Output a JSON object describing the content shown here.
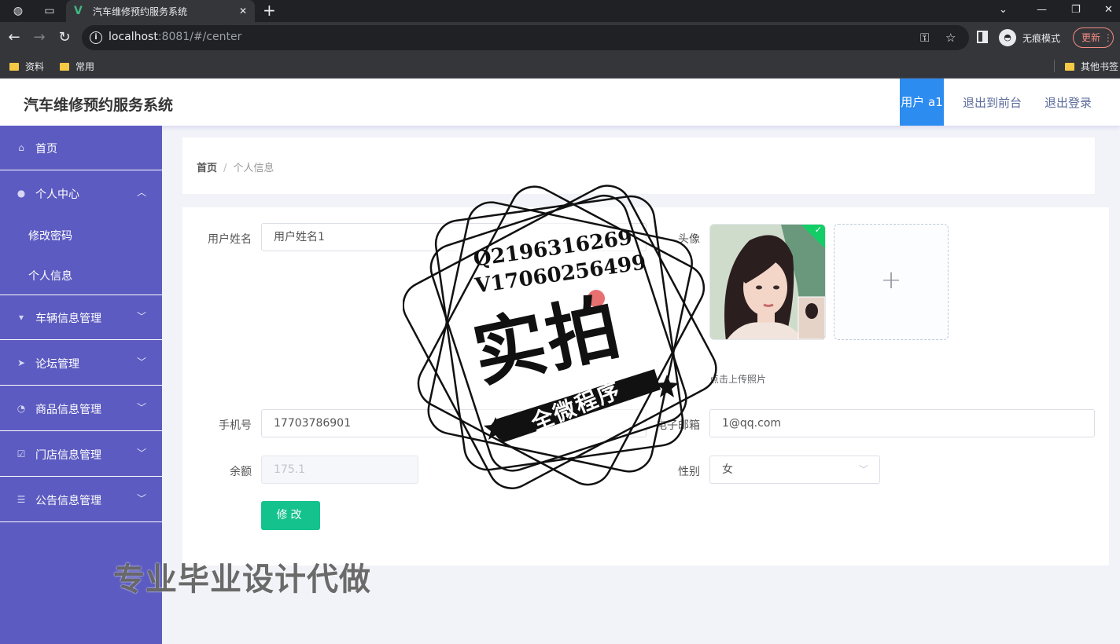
{
  "browser": {
    "tab_title": "汽车维修预约服务系统",
    "url_host": "localhost",
    "url_rest": ":8081/#/center",
    "incognito_label": "无痕模式",
    "update_label": "更新",
    "bookmarks": [
      "资料",
      "常用"
    ],
    "other_bookmarks": "其他书签"
  },
  "header": {
    "title": "汽车维修预约服务系统",
    "user": "用户 a1",
    "links": [
      "退出到前台",
      "退出登录"
    ]
  },
  "sidebar": {
    "items": [
      {
        "label": "首页",
        "icon": "home-icon"
      },
      {
        "label": "个人中心",
        "icon": "user-icon",
        "expanded": true,
        "children": [
          "修改密码",
          "个人信息"
        ]
      },
      {
        "label": "车辆信息管理",
        "icon": "car-icon"
      },
      {
        "label": "论坛管理",
        "icon": "forum-icon"
      },
      {
        "label": "商品信息管理",
        "icon": "goods-icon"
      },
      {
        "label": "门店信息管理",
        "icon": "store-icon"
      },
      {
        "label": "公告信息管理",
        "icon": "notice-icon"
      }
    ]
  },
  "breadcrumb": {
    "home": "首页",
    "separator": "/",
    "current": "个人信息"
  },
  "form": {
    "username_label": "用户姓名",
    "username_value": "用户姓名1",
    "avatar_label": "头像",
    "upload_tip": "点击上传照片",
    "phone_label": "手机号",
    "phone_value": "17703786901",
    "email_label": "电子邮箱",
    "email_value": "1@qq.com",
    "balance_label": "余额",
    "balance_value": "175.1",
    "gender_label": "性别",
    "gender_value": "女",
    "submit_label": "修改"
  },
  "watermark": {
    "contact_q": "Q2196316269",
    "contact_v": "V17060256499",
    "big_text": "实拍",
    "banner_text": "全微程序",
    "bottom_text": "专业毕业设计代做"
  },
  "colors": {
    "sidebar": "#5c5bc1",
    "accent_blue": "#2d8cf0",
    "submit_green": "#13c28c"
  }
}
